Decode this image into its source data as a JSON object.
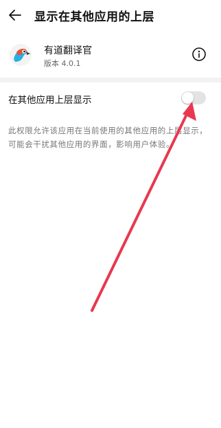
{
  "header": {
    "title": "显示在其他应用的上层",
    "back_icon": "back-arrow-icon"
  },
  "app": {
    "name": "有道翻译官",
    "version": "版本 4.0.1",
    "icon": "youdao-translator-app-icon",
    "info_icon": "info-icon"
  },
  "setting": {
    "label": "在其他应用上层显示",
    "toggle_on": false
  },
  "description": "此权限允许该应用在当前使用的其他应用的上层显示，可能会干扰其他应用的界面，影响用户体验。",
  "colors": {
    "annotation_arrow": "#e8384f",
    "toggle_off": "#e3e3e3",
    "divider": "#f2f2f2"
  }
}
